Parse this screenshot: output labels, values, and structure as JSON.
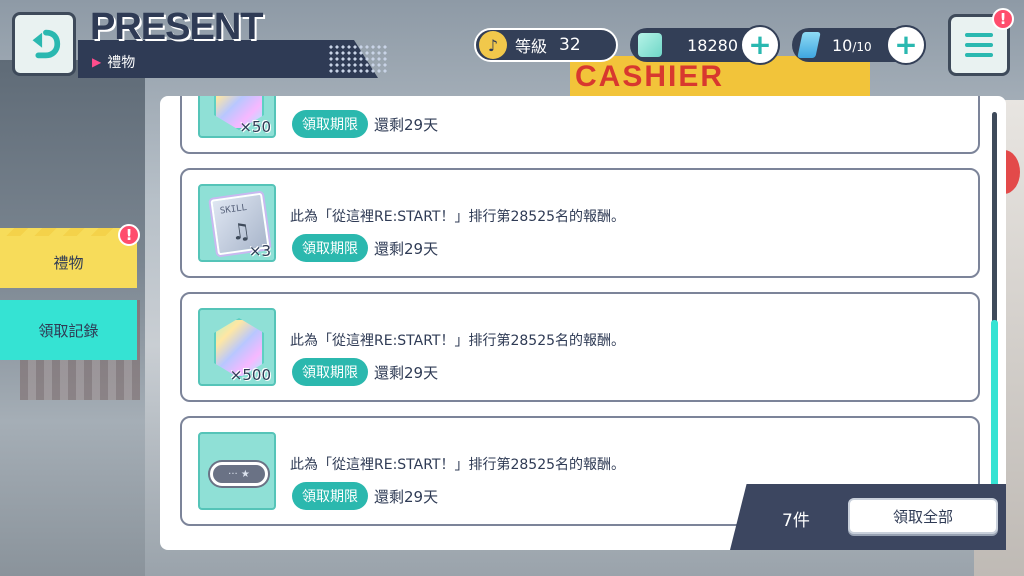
{
  "header": {
    "title_en": "PRESENT",
    "subtitle": "禮物",
    "back_icon": "back-arrow-icon",
    "menu_icon": "hamburger-icon"
  },
  "status": {
    "level_label": "等級",
    "level_value": "32",
    "gems": "18280",
    "energy_current": "10",
    "energy_max": "/10",
    "plus": "+"
  },
  "background": {
    "sign_text": "CASHIER"
  },
  "sidebar": {
    "tabs": [
      {
        "label": "禮物",
        "active": true
      },
      {
        "label": "領取記錄",
        "active": false
      }
    ],
    "alert": "!"
  },
  "menu_alert": "!",
  "items": [
    {
      "qty": "×50",
      "desc": "",
      "deadline_tag": "領取期限",
      "remain": "還剩29天",
      "icon": "gem-icon"
    },
    {
      "qty": "×3",
      "desc": "此為「從這裡RE:START！」排行第28525名的報酬。",
      "deadline_tag": "領取期限",
      "remain": "還剩29天",
      "icon": "skill-card-icon",
      "card_label": "SKILL"
    },
    {
      "qty": "×500",
      "desc": "此為「從這裡RE:START！」排行第28525名的報酬。",
      "deadline_tag": "領取期限",
      "remain": "還剩29天",
      "icon": "gem-icon"
    },
    {
      "qty": "",
      "desc": "此為「從這裡RE:START！」排行第28525名的報酬。",
      "deadline_tag": "領取期限",
      "remain": "還剩29天",
      "icon": "nameplate-icon",
      "plate_text": "··· ★"
    }
  ],
  "footer": {
    "count": "7件",
    "claim_all": "領取全部"
  },
  "colors": {
    "accent": "#35e3d3",
    "navy": "#2f3b55",
    "tab_yellow": "#f7dc5a",
    "deadline_tag": "#2bb8ae",
    "alert": "#ff4d6d"
  }
}
